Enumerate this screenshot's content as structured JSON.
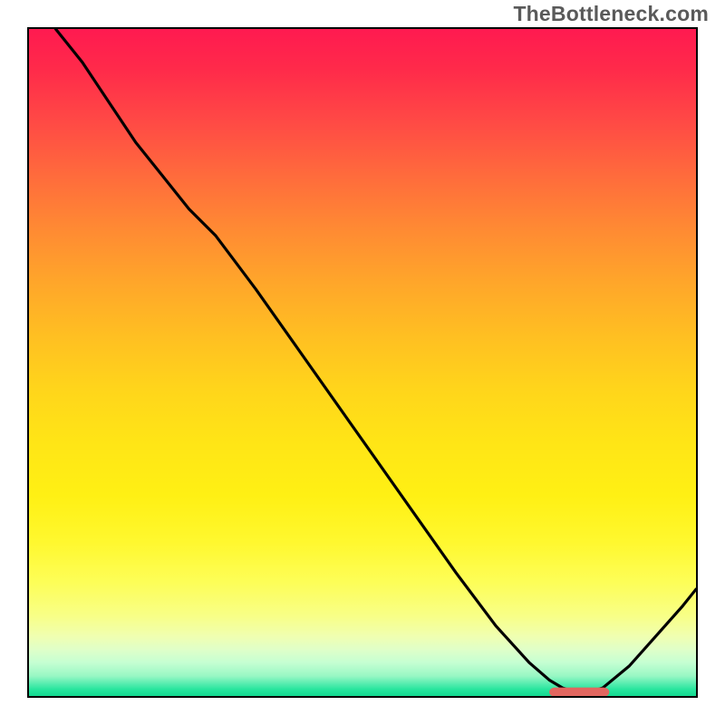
{
  "header": {
    "watermark": "TheBottleneck.com"
  },
  "chart_data": {
    "type": "line",
    "title": "",
    "xlabel": "",
    "ylabel": "",
    "xlim": [
      0,
      100
    ],
    "ylim": [
      0,
      100
    ],
    "grid": false,
    "legend": false,
    "series": [
      {
        "name": "curve",
        "x": [
          4,
          8,
          12,
          16,
          20,
          24,
          28,
          34,
          40,
          46,
          52,
          58,
          64,
          70,
          75,
          78,
          80,
          82,
          84,
          86,
          90,
          94,
          98,
          100
        ],
        "y": [
          100,
          95,
          89,
          83,
          78,
          73,
          69,
          61,
          52.5,
          44,
          35.5,
          27,
          18.5,
          10.5,
          5,
          2.4,
          1.2,
          0.6,
          0.6,
          1.2,
          4.5,
          9,
          13.5,
          16
        ]
      }
    ],
    "marker": {
      "name": "optimum-range",
      "x_start": 78,
      "x_end": 87,
      "y": 0.6,
      "color": "#e1665f"
    },
    "background": {
      "type": "vertical-gradient",
      "stops": [
        {
          "pos": 0,
          "color": "#ff1a50"
        },
        {
          "pos": 0.5,
          "color": "#ffd51b"
        },
        {
          "pos": 0.88,
          "color": "#f0ffb0"
        },
        {
          "pos": 1.0,
          "color": "#11d88f"
        }
      ]
    }
  }
}
